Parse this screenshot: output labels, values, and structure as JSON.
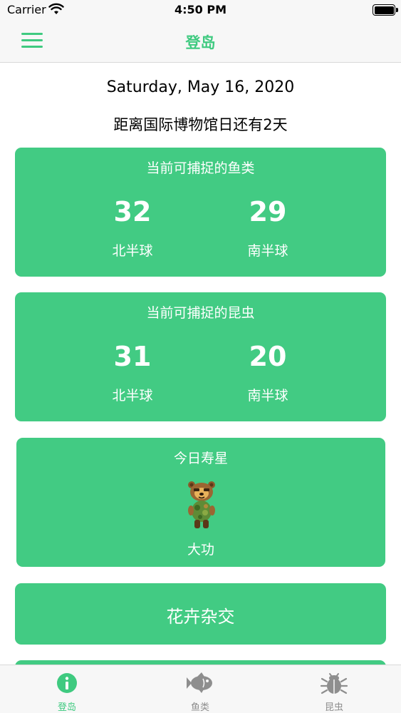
{
  "status_bar": {
    "carrier": "Carrier",
    "time": "4:50 PM",
    "battery_level": 1.0
  },
  "nav": {
    "title": "登岛",
    "menu_icon": "hamburger-menu-icon"
  },
  "date": "Saturday, May 16, 2020",
  "countdown": "距离国际博物馆日还有2天",
  "fish_card": {
    "title": "当前可捕捉的鱼类",
    "north_count": "32",
    "south_count": "29",
    "north_label": "北半球",
    "south_label": "南半球"
  },
  "insect_card": {
    "title": "当前可捕捉的昆虫",
    "north_count": "31",
    "south_count": "20",
    "north_label": "北半球",
    "south_label": "南半球"
  },
  "birthday_card": {
    "title": "今日寿星",
    "villager_name": "大功",
    "villager_icon": "bear-villager-avatar"
  },
  "flower_card": {
    "label": "花卉杂交"
  },
  "tabs": [
    {
      "label": "登岛",
      "icon": "info-circle-icon",
      "active": true
    },
    {
      "label": "鱼类",
      "icon": "fish-icon",
      "active": false
    },
    {
      "label": "昆虫",
      "icon": "bug-icon",
      "active": false
    }
  ],
  "colors": {
    "accent": "#3fca80",
    "card": "#42cb83",
    "inactive": "#8e8e8e"
  }
}
